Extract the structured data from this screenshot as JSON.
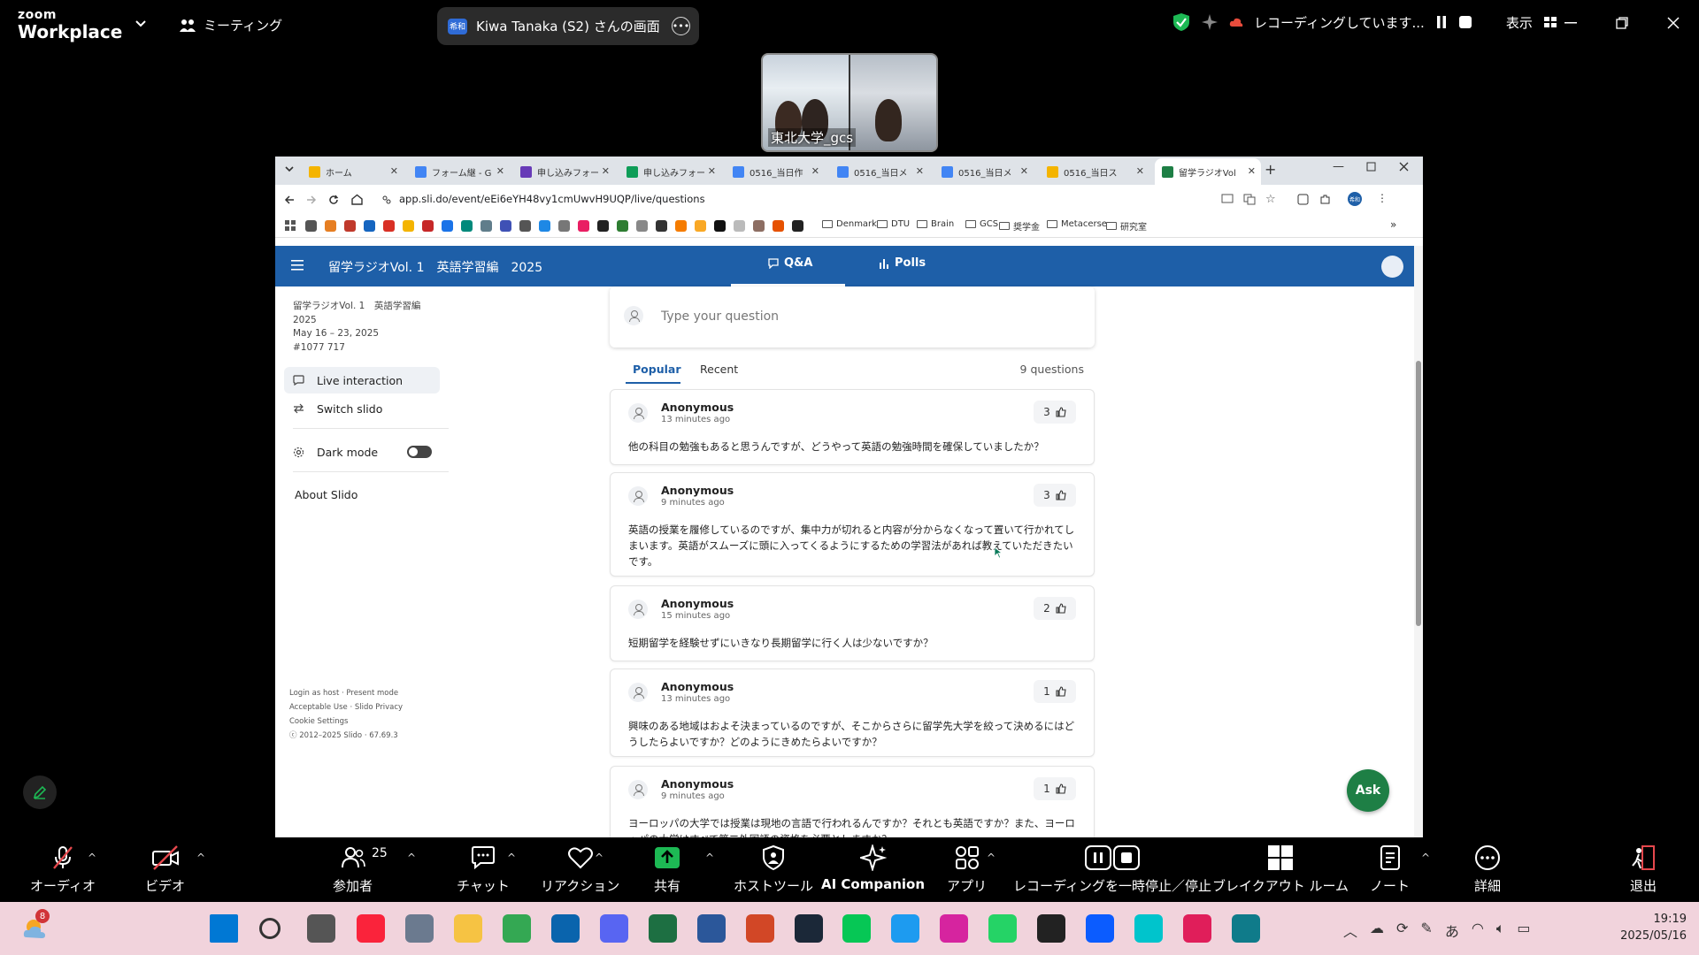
{
  "zoom": {
    "logo_line1": "zoom",
    "logo_line2": "Workplace",
    "meeting_label": "ミーティング",
    "share_badge": "希和",
    "share_title": "Kiwa Tanaka (S2) さんの画面",
    "recording_text": "レコーディングしています...",
    "view_label": "表示",
    "video_name": "東北大学_gcs"
  },
  "browser": {
    "tabs": [
      {
        "title": "ホーム",
        "color": "#f4b400"
      },
      {
        "title": "フォーム継 - G",
        "color": "#4285f4"
      },
      {
        "title": "申し込みフォー",
        "color": "#673ab7"
      },
      {
        "title": "申し込みフォー",
        "color": "#0f9d58"
      },
      {
        "title": "0516_当日作",
        "color": "#4285f4"
      },
      {
        "title": "0516_当日メ",
        "color": "#4285f4"
      },
      {
        "title": "0516_当日メ",
        "color": "#4285f4"
      },
      {
        "title": "0516_当日ス",
        "color": "#f4b400"
      },
      {
        "title": "留学ラジオVol",
        "color": "#1e7f45"
      }
    ],
    "url": "app.sli.do/event/eEi6eYH48vy1cmUwvH9UQP/live/questions",
    "profile_badge": "希和",
    "bookmark_folders": [
      "Denmark",
      "DTU",
      "Brain",
      "GCS",
      "奨学金",
      "Metacerse",
      "研究室"
    ]
  },
  "slido": {
    "header_title": "留学ラジオVol. 1　英語学習編　2025",
    "tab_qa": "Q&A",
    "tab_polls": "Polls",
    "event_name": "留学ラジオVol. 1　英語学習編",
    "event_year": "2025",
    "event_dates": "May 16 – 23, 2025",
    "event_code": "#1077 717",
    "nav": {
      "live_interaction": "Live interaction",
      "switch_slido": "Switch slido",
      "dark_mode": "Dark mode",
      "about": "About Slido"
    },
    "footer": {
      "line1": "Login as host · Present mode",
      "line2": "Acceptable Use · Slido Privacy",
      "line3": "Cookie Settings",
      "line4": "ⓒ 2012–2025 Slido · 67.69.3"
    },
    "ask_placeholder": "Type your question",
    "sort_popular": "Popular",
    "sort_recent": "Recent",
    "question_count": "9 questions",
    "questions": [
      {
        "author": "Anonymous",
        "time": "13 minutes ago",
        "likes": "3",
        "text": "他の科目の勉強もあると思うんですが、どうやって英語の勉強時間を確保していましたか？"
      },
      {
        "author": "Anonymous",
        "time": "9 minutes ago",
        "likes": "3",
        "text": "英語の授業を履修しているのですが、集中力が切れると内容が分からなくなって置いて行かれてしまいます。英語がスムーズに頭に入ってくるようにするための学習法があれば教えていただきたいです。"
      },
      {
        "author": "Anonymous",
        "time": "15 minutes ago",
        "likes": "2",
        "text": "短期留学を経験せずにいきなり長期留学に行く人は少ないですか？"
      },
      {
        "author": "Anonymous",
        "time": "13 minutes ago",
        "likes": "1",
        "text": "興味のある地域はおよそ決まっているのですが、そこからさらに留学先大学を絞って決めるにはどうしたらよいですか？どのようにきめたらよいですか？"
      },
      {
        "author": "Anonymous",
        "time": "9 minutes ago",
        "likes": "1",
        "text": "ヨーロッパの大学では授業は現地の言語で行われるんですか？それとも英語ですか？また、ヨーロッパの大学はすべて第二外国語の資格を必要としますか？"
      }
    ],
    "ask_button": "Ask"
  },
  "toolbar": {
    "audio": "オーディオ",
    "video": "ビデオ",
    "participants": "参加者",
    "participants_count": "25",
    "chat": "チャット",
    "reactions": "リアクション",
    "share": "共有",
    "host_tools": "ホストツール",
    "ai_companion": "AI Companion",
    "apps": "アプリ",
    "recording": "レコーディングを一時停止／停止",
    "breakout": "ブレイクアウト ルーム",
    "notes": "ノート",
    "more": "詳細",
    "leave": "退出"
  },
  "taskbar": {
    "weather_badge": "8",
    "ime": "あ",
    "time": "19:19",
    "date": "2025/05/16"
  },
  "colors": {
    "slido_blue": "#1e5fa8",
    "ask_green": "#1e7f45",
    "taskbar_pink": "#f1d3dc"
  }
}
